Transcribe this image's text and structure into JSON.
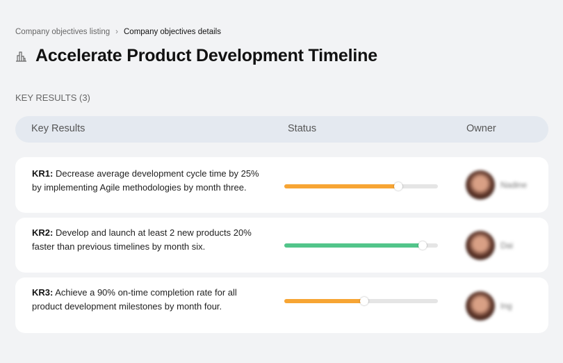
{
  "breadcrumb": {
    "parent": "Company objectives listing",
    "separator": "›",
    "current": "Company objectives details"
  },
  "page": {
    "title": "Accelerate Product Development Timeline",
    "icon": "buildings-icon"
  },
  "section": {
    "label": "KEY RESULTS (3)"
  },
  "table": {
    "headers": {
      "key_results": "Key Results",
      "status": "Status",
      "owner": "Owner"
    },
    "rows": [
      {
        "id": "KR1:",
        "text": " Decrease average development cycle time by 25% by implementing Agile methodologies by month three.",
        "progress": 0.74,
        "color": "#f7a534",
        "owner": "Nadine"
      },
      {
        "id": "KR2:",
        "text": " Develop and launch at least 2 new products 20% faster than previous timelines by month six.",
        "progress": 0.9,
        "color": "#52c58a",
        "owner": "Dai"
      },
      {
        "id": "KR3:",
        "text": " Achieve a 90% on-time completion rate for all product development milestones by month four.",
        "progress": 0.52,
        "color": "#f7a534",
        "owner": "Ing"
      }
    ]
  }
}
